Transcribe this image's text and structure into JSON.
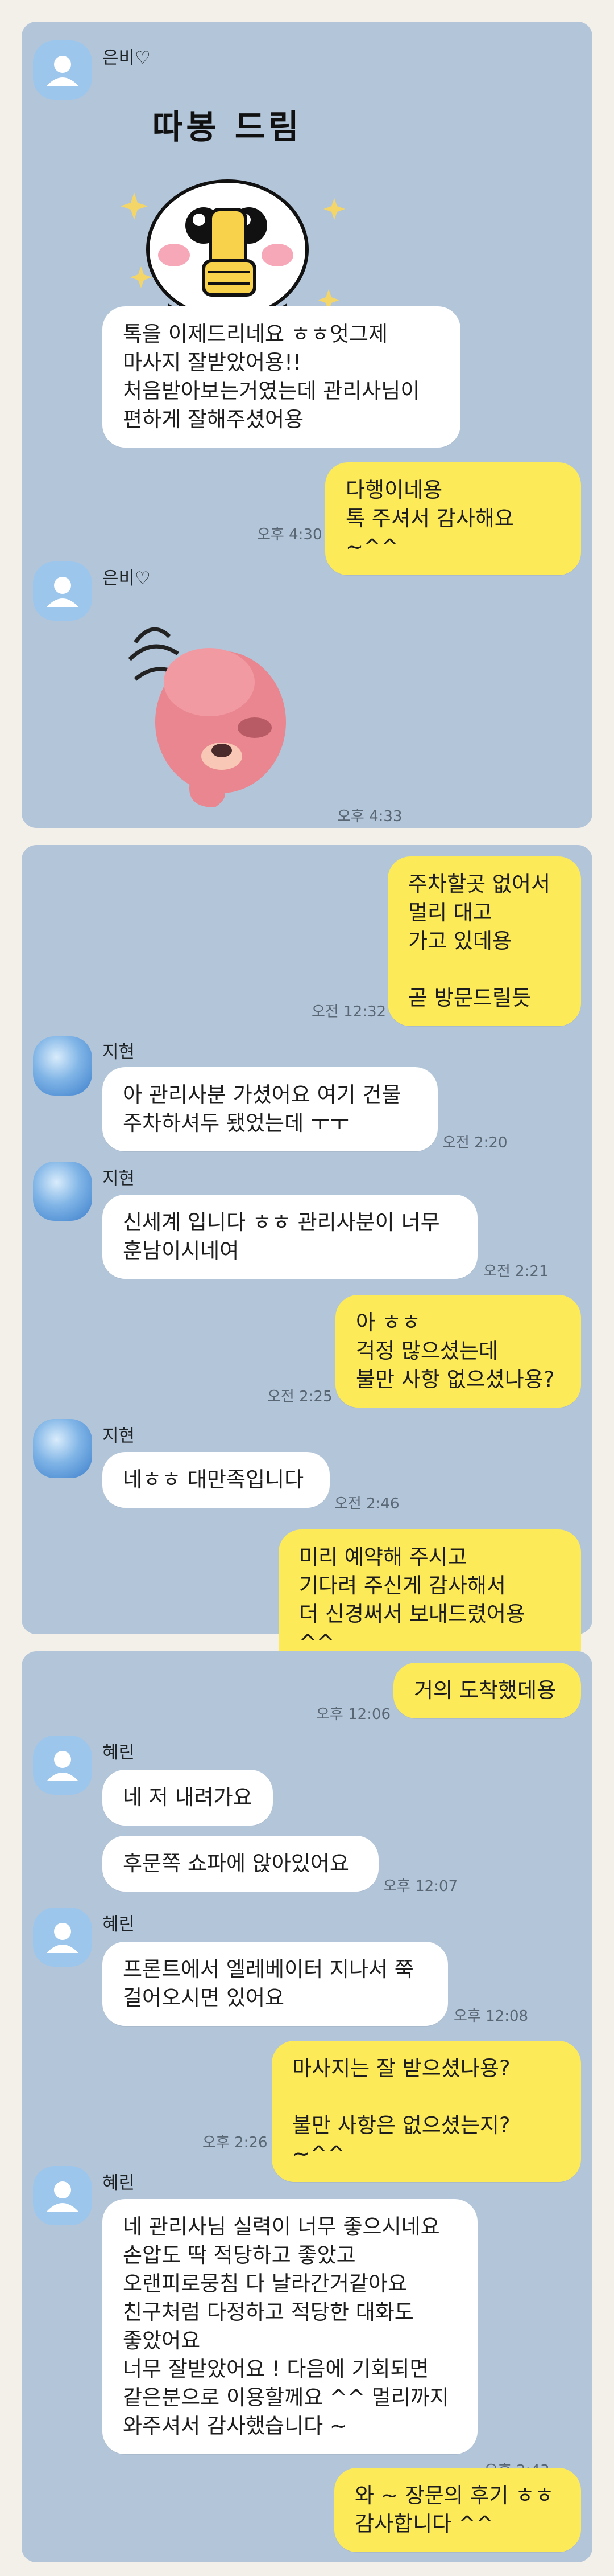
{
  "chat1": {
    "sender_name": "은비♡",
    "sticker1_text": "따봉 드림",
    "msg_in_1": "톡을 이제드리네요 ㅎㅎ엇그제\n마사지 잘받았어용!!\n처음받아보는거였는데 관리사님이\n편하게 잘해주셨어용",
    "msg_out_1": "다행이네용\n톡 주셔서 감사해요 ~^^",
    "time_1": "오후 4:30",
    "sender_name_2": "은비♡",
    "time_2": "오후 4:33"
  },
  "chat2": {
    "msg_out_1": "주차할곳 없어서\n멀리 대고\n가고 있데용\n\n곧 방문드릴듯",
    "time_1": "오전 12:32",
    "sender_1": "지현",
    "msg_in_1": "아 관리사분 가셨어요 여기 건물\n주차하셔두 됐었는데 ㅜㅜ",
    "time_2": "오전 2:20",
    "sender_2": "지현",
    "msg_in_2": "신세계 입니다 ㅎㅎ 관리사분이 너무\n훈남이시네여",
    "time_3": "오전 2:21",
    "msg_out_2": "아 ㅎㅎ\n걱정 많으셨는데\n불만 사항 없으셨나용?",
    "time_4": "오전 2:25",
    "sender_3": "지현",
    "msg_in_3": "네ㅎㅎ 대만족입니다",
    "time_5": "오전 2:46",
    "msg_out_3": "미리 예약해 주시고\n기다려 주신게 감사해서\n더 신경써서 보내드렸어용 ^^"
  },
  "chat3": {
    "msg_out_1": "거의 도착했데용",
    "time_1": "오후 12:06",
    "sender_1": "혜린",
    "msg_in_1": "네 저 내려가요",
    "msg_in_2": "후문쪽 쇼파에 앉아있어요",
    "time_2": "오후 12:07",
    "sender_2": "혜린",
    "msg_in_3": "프론트에서 엘레베이터 지나서 쭉\n걸어오시면 있어요",
    "time_3": "오후 12:08",
    "msg_out_2": "마사지는 잘 받으셨나용?\n\n불만 사항은 없으셨는지? ~^^",
    "time_4": "오후 2:26",
    "sender_3": "혜린",
    "msg_in_4": "네 관리사님 실력이 너무 좋으시네요\n손압도 딱 적당하고 좋았고\n오랜피로뭉침 다 날라간거같아요\n친구처럼 다정하고 적당한 대화도\n좋았어요\n너무 잘받았어요 ! 다음에 기회되면\n같은분으로 이용할께요 ^^ 멀리까지\n와주셔서 감사했습니다 ~",
    "time_5": "오후 2:43",
    "msg_out_3": "와 ~ 장문의 후기 ㅎㅎ\n감사합니다 ^^"
  },
  "colors": {
    "panel_bg": "#b3c5d9",
    "outgoing_bubble": "#fdea58",
    "incoming_bubble": "#ffffff",
    "page_bg": "#f3efe9"
  },
  "icons": {
    "default_avatar": "person-silhouette-icon",
    "sticker_1": "thumbs-up-character-sticker",
    "sticker_2": "pink-beaver-bowing-sticker"
  }
}
